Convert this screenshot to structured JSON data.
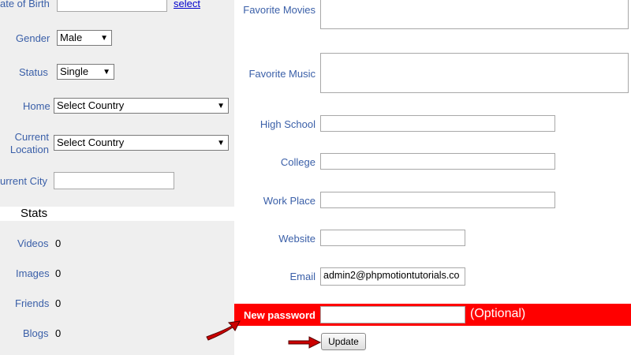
{
  "left": {
    "dob_label": "ate of Birth",
    "dob_link": "select",
    "gender_label": "Gender",
    "gender_value": "Male",
    "status_label": "Status",
    "status_value": "Single",
    "home_label": "Home",
    "home_value": "Select Country",
    "current_location_label_1": "Current",
    "current_location_label_2": "Location",
    "current_location_value": "Select Country",
    "current_city_label": "urrent City",
    "stats_title": "Stats",
    "stats": [
      {
        "label": "Videos",
        "value": "0"
      },
      {
        "label": "Images",
        "value": "0"
      },
      {
        "label": "Friends",
        "value": "0"
      },
      {
        "label": "Blogs",
        "value": "0"
      }
    ]
  },
  "right": {
    "favorite_movies_label": "Favorite Movies",
    "favorite_music_label": "Favorite Music",
    "high_school_label": "High School",
    "college_label": "College",
    "work_place_label": "Work Place",
    "website_label": "Website",
    "email_label": "Email",
    "email_value": "admin2@phpmotiontutorials.co",
    "new_password_label": "New password",
    "optional_note": "(Optional)",
    "update_button": "Update"
  },
  "colors": {
    "label_blue": "#3a5fa8",
    "highlight_red": "#ff0000",
    "panel_gray": "#efefef"
  }
}
